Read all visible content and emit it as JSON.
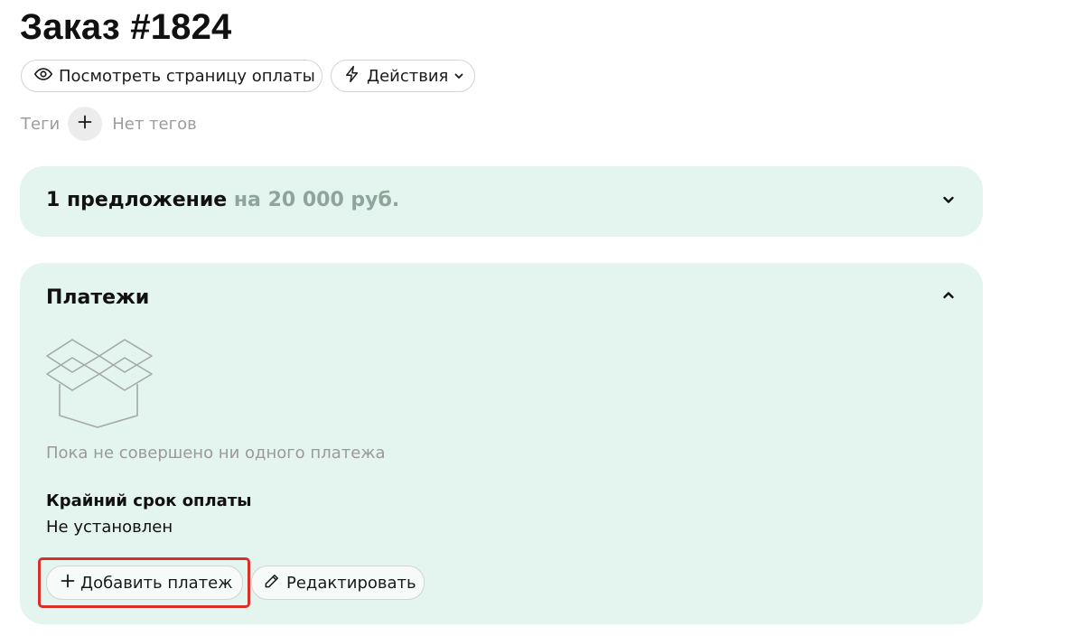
{
  "header": {
    "title": "Заказ #1824"
  },
  "toolbar": {
    "view_payment_page_label": "Посмотреть страницу оплаты",
    "actions_label": "Действия"
  },
  "tags": {
    "label": "Теги",
    "empty_text": "Нет тегов"
  },
  "offers": {
    "count_text": "1 предложение",
    "amount_text": "на 20 000 руб.",
    "expanded": false
  },
  "payments": {
    "title": "Платежи",
    "expanded": true,
    "empty_text": "Пока не совершено ни одного платежа",
    "deadline_label": "Крайний срок оплаты",
    "deadline_value": "Не установлен",
    "add_payment_label": "Добавить платеж",
    "edit_label": "Редактировать"
  },
  "colors": {
    "card_background": "#e4f4ee",
    "muted_text": "#9c9c9c",
    "highlight": "#d9302c"
  },
  "icons": {
    "view": "eye-icon",
    "actions": "lightning-icon",
    "actions_dropdown": "chevron-down-icon",
    "add_tag": "plus-icon",
    "offers_toggle": "chevron-down-icon",
    "payments_toggle": "chevron-up-icon",
    "empty_state": "open-box-icon",
    "add_payment": "plus-icon",
    "edit": "pencil-icon"
  }
}
